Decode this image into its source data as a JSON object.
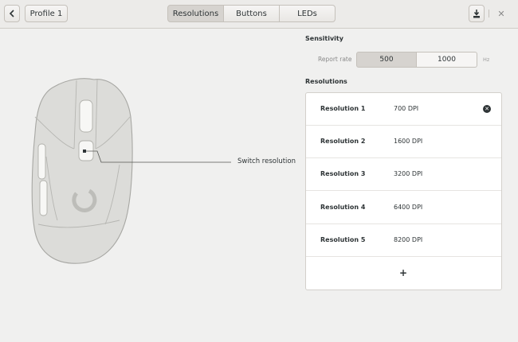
{
  "header": {
    "back_icon": "chevron-left-icon",
    "profile_label": "Profile 1",
    "tabs": [
      {
        "label": "Resolutions",
        "active": true
      },
      {
        "label": "Buttons",
        "active": false
      },
      {
        "label": "LEDs",
        "active": false
      }
    ],
    "save_icon": "download-icon",
    "close_icon": "close-icon"
  },
  "mouse": {
    "callout_label": "Switch resolution"
  },
  "sensitivity": {
    "title": "Sensitivity",
    "report_rate_label": "Report rate",
    "rates": [
      {
        "label": "500",
        "selected": true
      },
      {
        "label": "1000",
        "selected": false
      }
    ],
    "unit": "Hz"
  },
  "resolutions": {
    "title": "Resolutions",
    "items": [
      {
        "name": "Resolution 1",
        "value": "700 DPI",
        "removable": true
      },
      {
        "name": "Resolution 2",
        "value": "1600 DPI",
        "removable": false
      },
      {
        "name": "Resolution 3",
        "value": "3200 DPI",
        "removable": false
      },
      {
        "name": "Resolution 4",
        "value": "6400 DPI",
        "removable": false
      },
      {
        "name": "Resolution 5",
        "value": "8200 DPI",
        "removable": false
      }
    ],
    "add_label": "+"
  }
}
